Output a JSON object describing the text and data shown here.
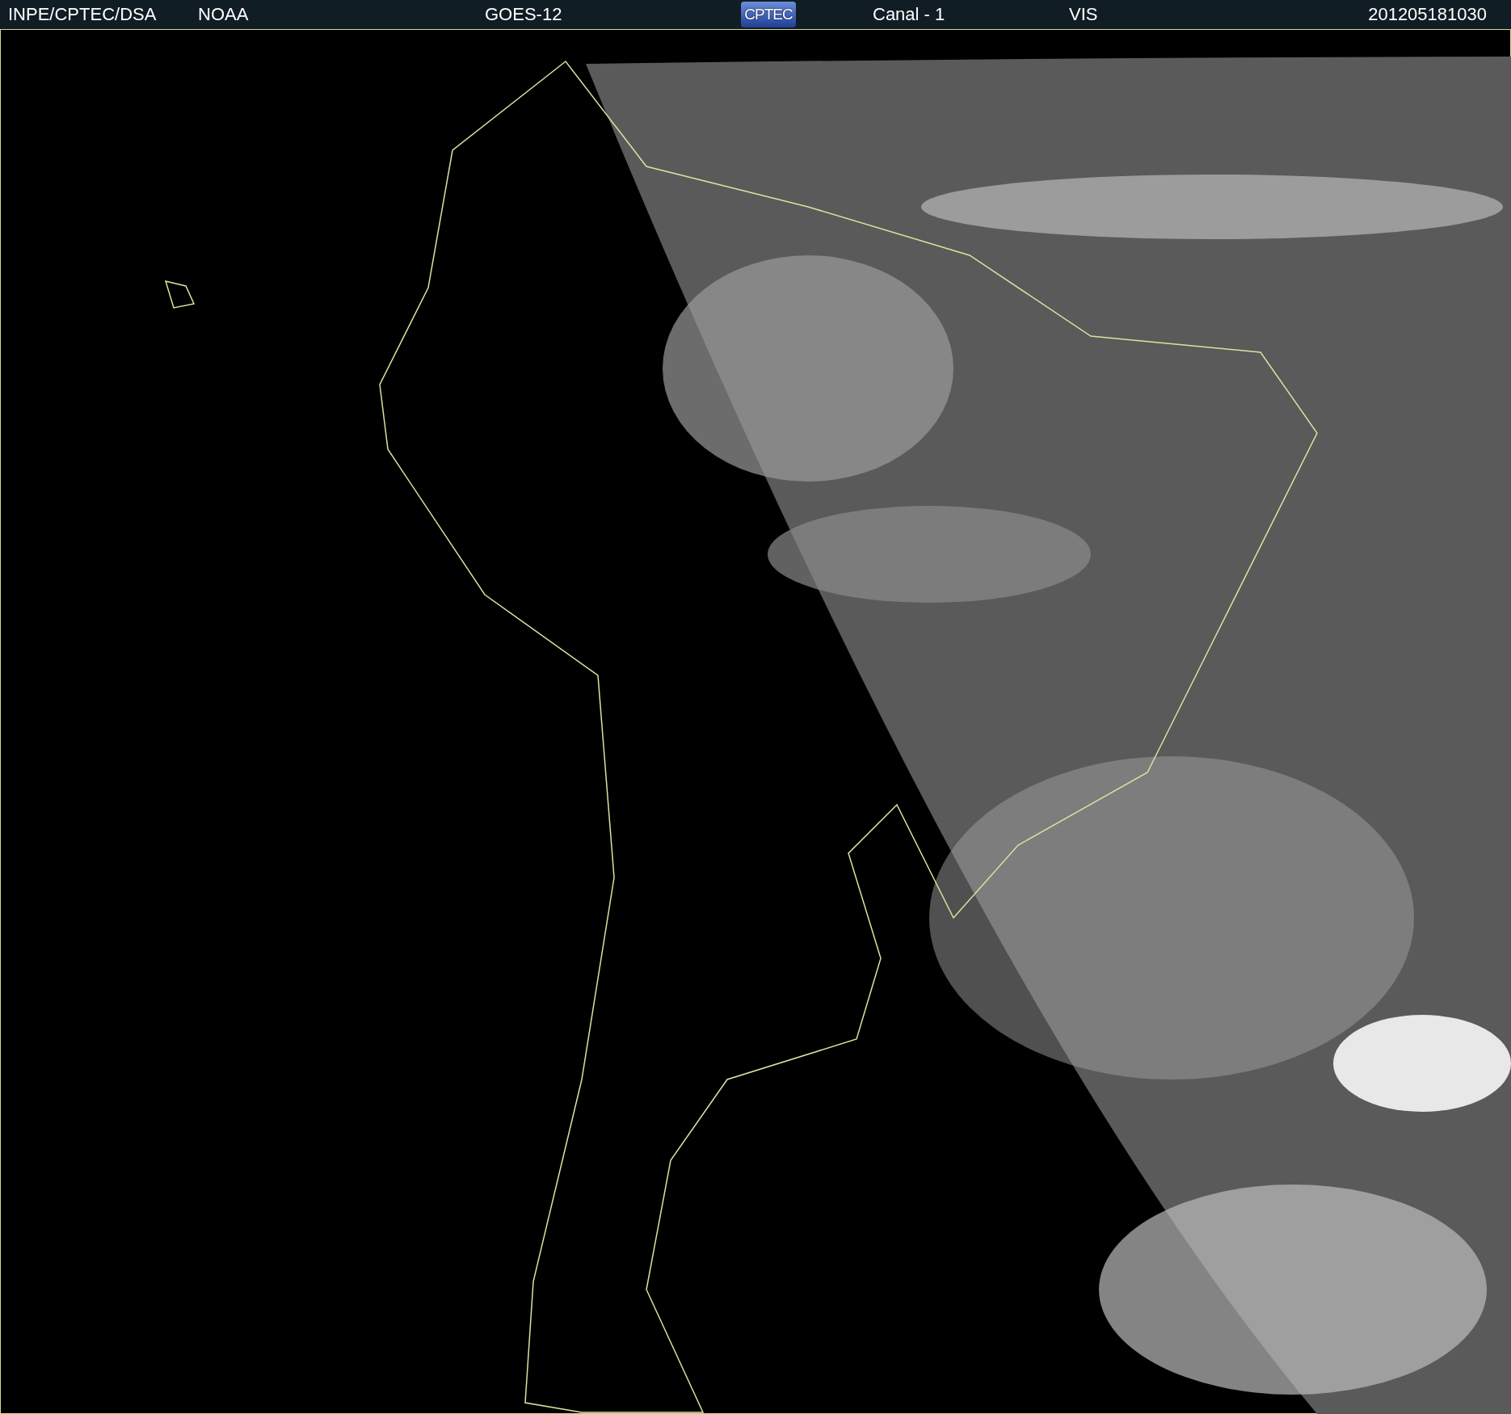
{
  "header": {
    "items": [
      {
        "kind": "text",
        "text": "INPE/CPTEC/DSA"
      },
      {
        "kind": "text",
        "text": "NOAA"
      },
      {
        "kind": "text",
        "text": "GOES-12"
      },
      {
        "kind": "logo",
        "text": "CPTEC"
      },
      {
        "kind": "text",
        "text": "Canal - 1"
      },
      {
        "kind": "text",
        "text": "VIS"
      },
      {
        "kind": "text",
        "text": "201205181030"
      }
    ]
  }
}
